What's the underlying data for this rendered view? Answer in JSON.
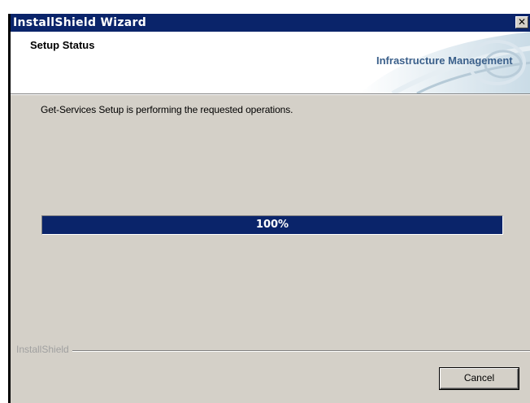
{
  "window": {
    "title": "InstallShield Wizard",
    "close_glyph": "✕",
    "close_icon": "close-icon"
  },
  "header": {
    "title": "Setup Status",
    "brand": "Infrastructure Management"
  },
  "main": {
    "status_text": "Get-Services Setup is performing the requested operations.",
    "progress_percent": 100,
    "progress_label": "100%"
  },
  "footer": {
    "brand": "InstallShield",
    "cancel_label": "Cancel"
  },
  "colors": {
    "titlebar": "#0a246a",
    "progress": "#0a246a",
    "dialog_bg": "#d4d0c8",
    "brand_text": "#3a5f8a"
  }
}
